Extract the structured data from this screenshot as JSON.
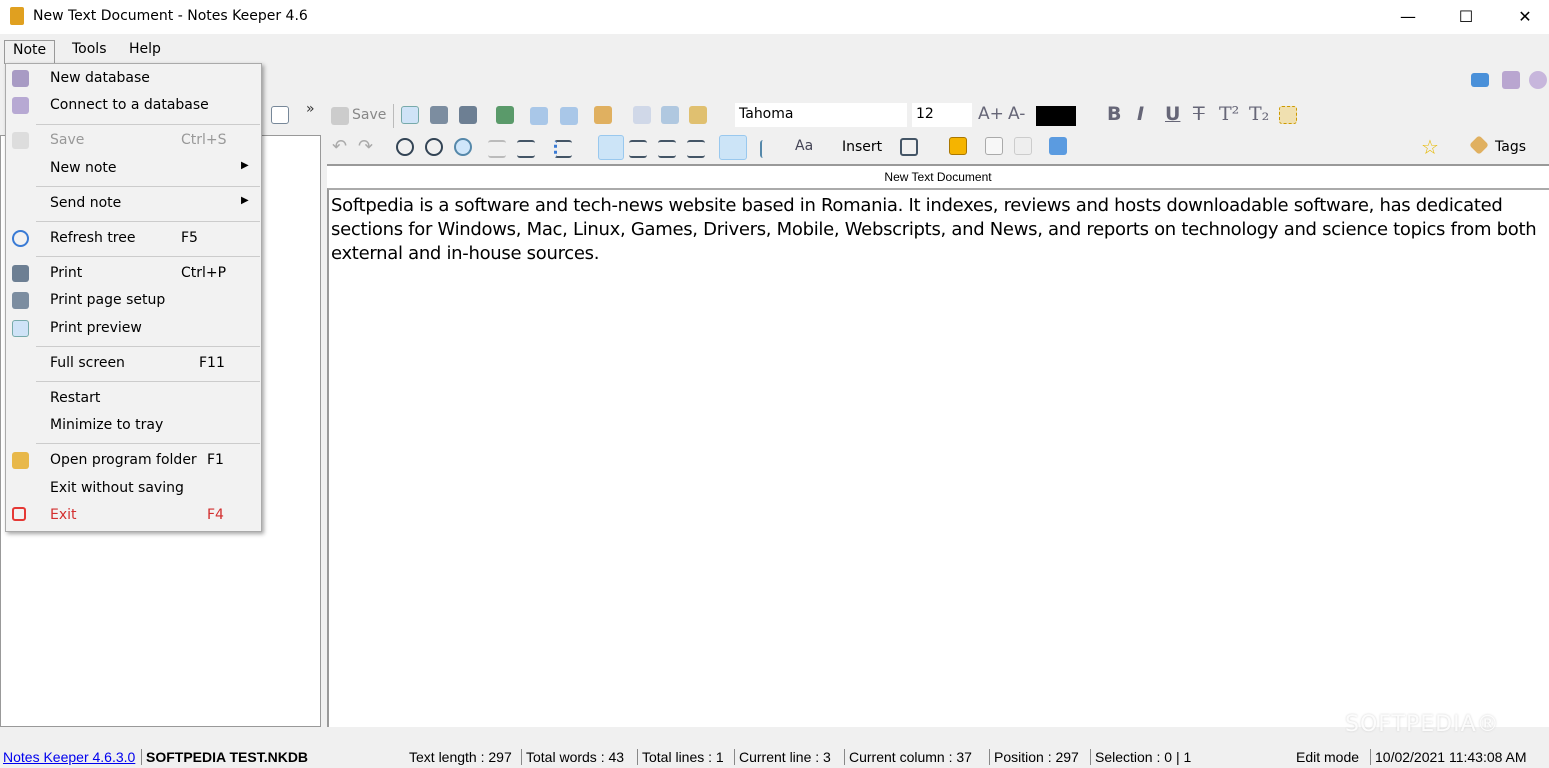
{
  "window": {
    "title": "New Text Document - Notes Keeper 4.6",
    "minimize": "—",
    "maximize": "☐",
    "close": "✕"
  },
  "menubar": [
    "Note",
    "Tools",
    "Help"
  ],
  "toolbar": {
    "save_label": "Save",
    "more": "»",
    "font": "Tahoma",
    "size": "12",
    "insert_label": "Insert",
    "tags_label": "Tags",
    "text_color": "#000000",
    "format_glyphs": {
      "bold": "B",
      "italic": "I",
      "underline": "U",
      "strike": "T",
      "superscript": "T²",
      "subscript": "T₂",
      "grow": "A+",
      "shrink": "A-",
      "case": "Aa"
    }
  },
  "note_menu": [
    {
      "label": "New database",
      "icon": "database-add-icon"
    },
    {
      "label": "Connect to a database",
      "icon": "database-icon"
    },
    {
      "label": "Save",
      "shortcut": "Ctrl+S",
      "icon": "save-icon",
      "disabled": true
    },
    {
      "label": "New note",
      "submenu": true
    },
    {
      "label": "Send note",
      "submenu": true
    },
    {
      "label": "Refresh tree",
      "shortcut": "F5",
      "icon": "refresh-icon"
    },
    {
      "label": "Print",
      "shortcut": "Ctrl+P",
      "icon": "print-icon"
    },
    {
      "label": "Print page setup",
      "icon": "print-setup-icon"
    },
    {
      "label": "Print preview",
      "icon": "preview-icon"
    },
    {
      "label": "Full screen",
      "shortcut": "F11"
    },
    {
      "label": "Restart"
    },
    {
      "label": "Minimize to tray"
    },
    {
      "label": "Open program folder",
      "shortcut": "F1",
      "icon": "folder-icon"
    },
    {
      "label": "Exit without saving"
    },
    {
      "label": "Exit",
      "shortcut": "F4",
      "icon": "exit-icon",
      "color": "#d32f2f"
    }
  ],
  "submenu_arrow": "▶",
  "editor": {
    "note_title": "New Text Document",
    "content": "Softpedia is a software and tech-news website based in Romania. It indexes, reviews and hosts downloadable software, has dedicated sections for Windows, Mac, Linux, Games, Drivers, Mobile, Webscripts, and News, and reports on technology and science topics from both external and in-house sources."
  },
  "statusbar": {
    "version_link": "Notes Keeper 4.6.3.0",
    "database": "SOFTPEDIA TEST.NKDB",
    "text_length": "Text length : 297",
    "total_words": "Total words : 43",
    "total_lines": "Total lines : 1",
    "current_line": "Current line : 3",
    "current_column": "Current column : 37",
    "position": "Position : 297",
    "selection": "Selection : 0 | 1",
    "mode": "Edit mode",
    "datetime": "10/02/2021 11:43:08 AM"
  },
  "watermark": "SOFTPEDIA®"
}
